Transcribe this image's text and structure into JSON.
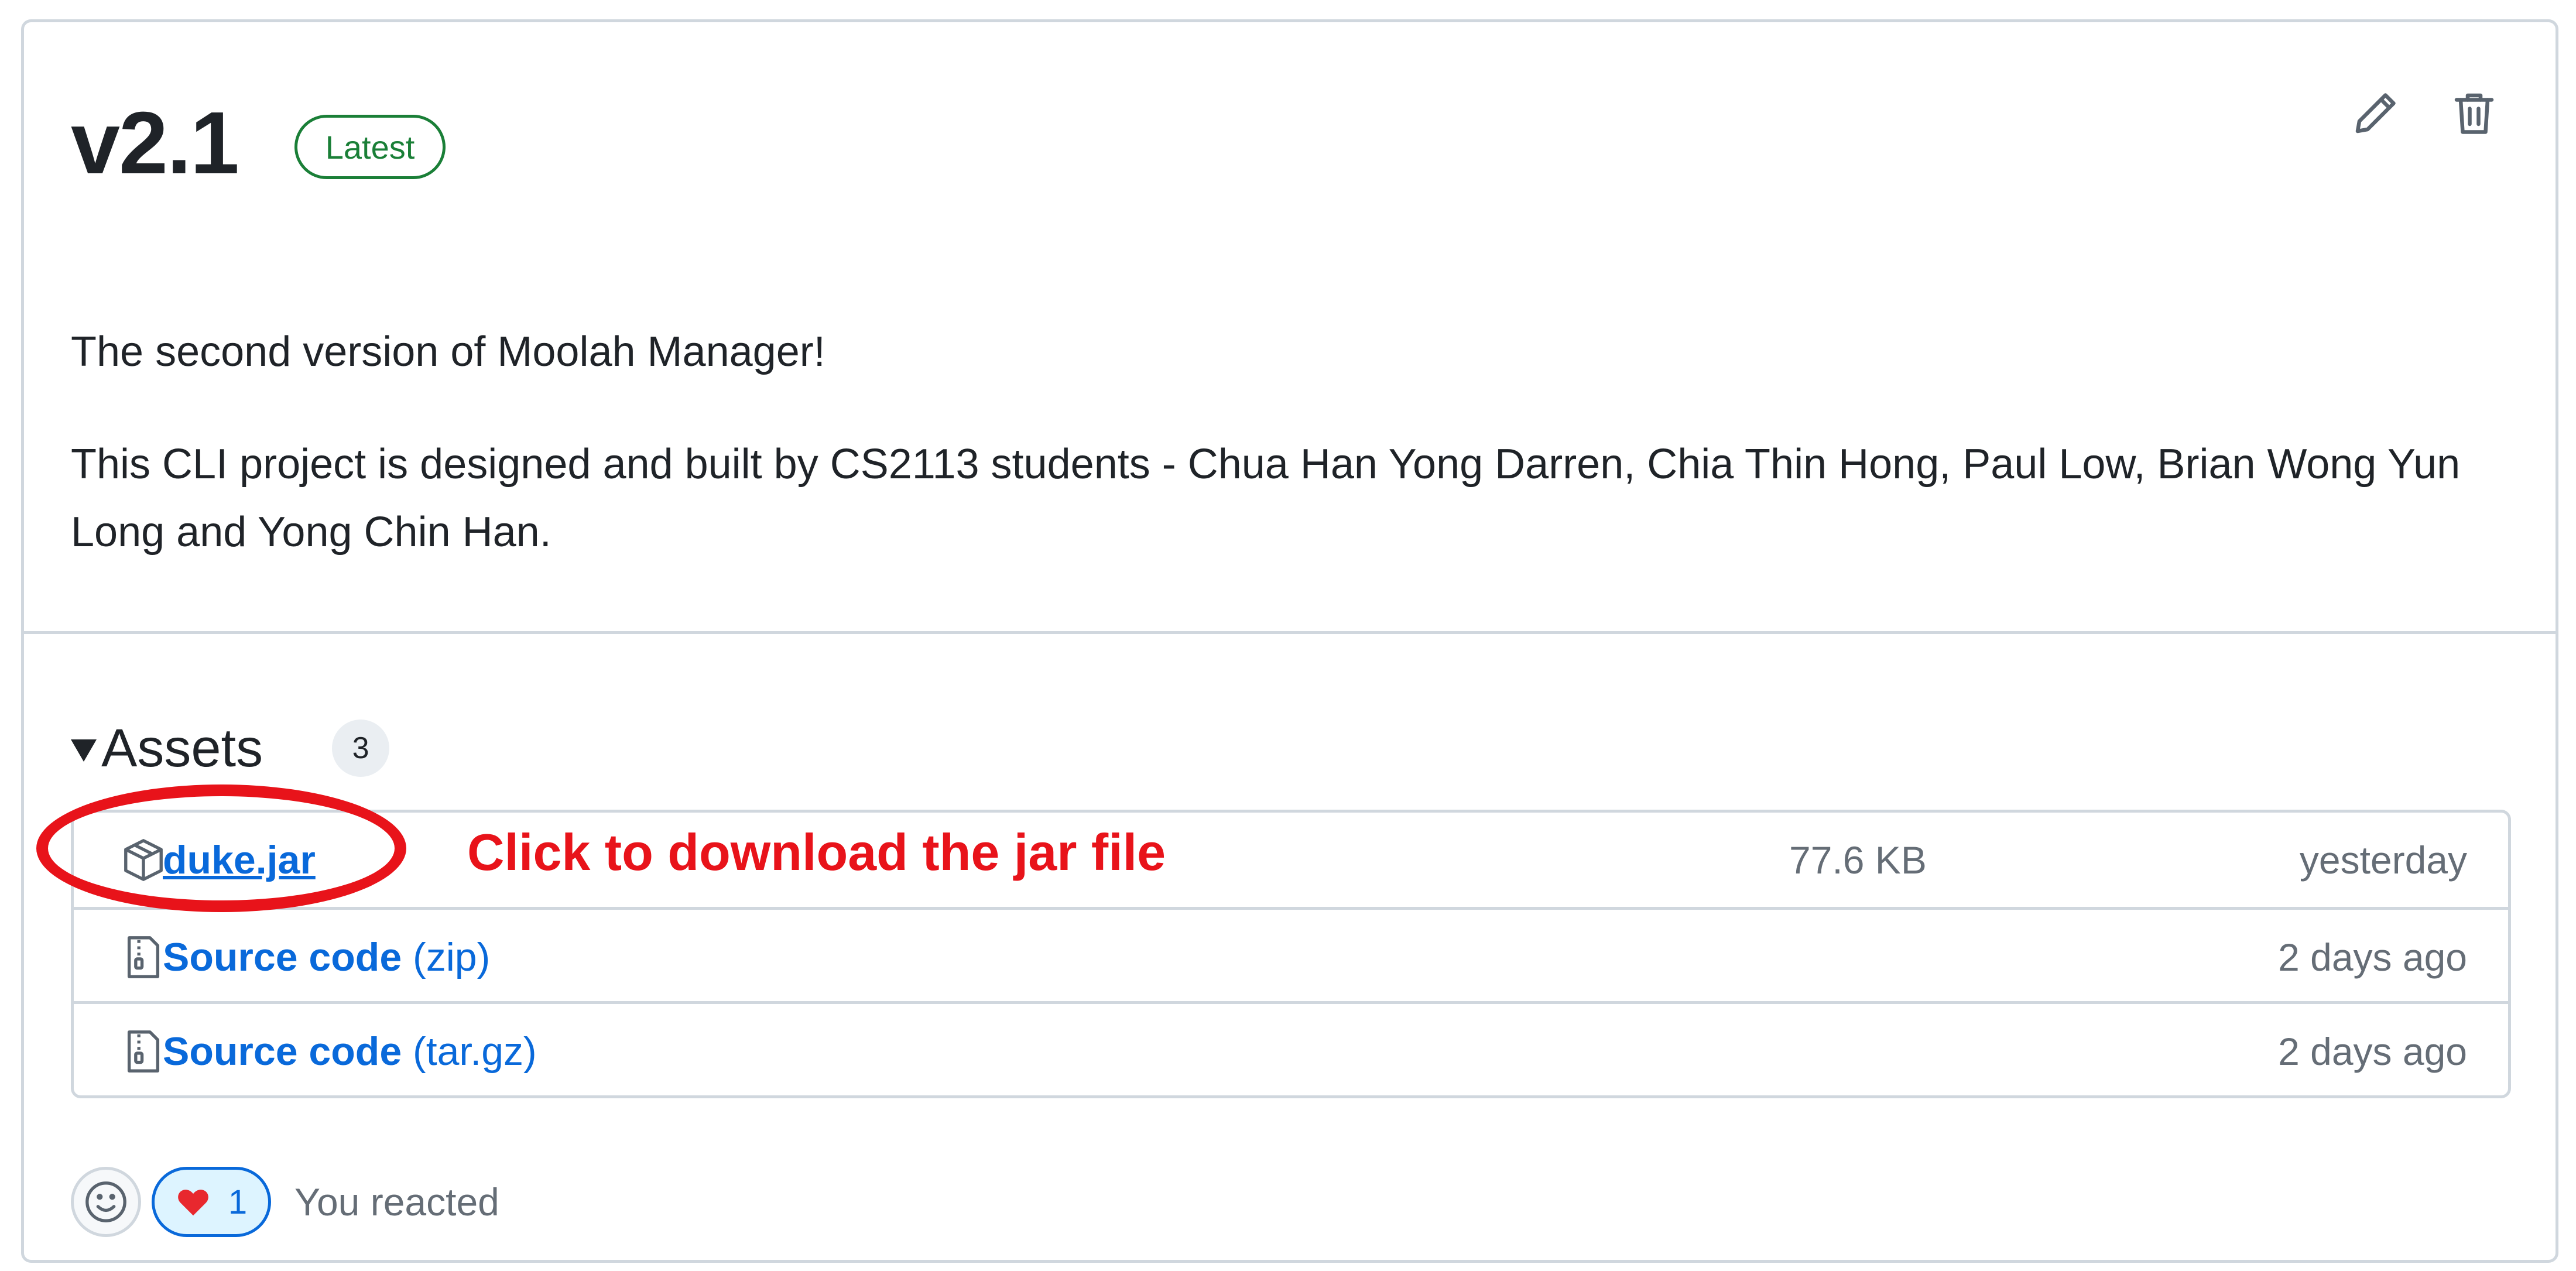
{
  "release": {
    "title": "v2.1",
    "badge": "Latest",
    "body": {
      "line1": "The second version of Moolah Manager!",
      "line2": "This CLI project is designed and built by CS2113 students - Chua Han Yong Darren, Chia Thin Hong, Paul Low, Brian Wong Yun Long and Yong Chin Han."
    },
    "icons": {
      "edit": "pencil-icon",
      "delete": "trash-icon"
    }
  },
  "assets": {
    "title": "Assets",
    "count": "3",
    "items": [
      {
        "name": "duke.jar",
        "ext": "",
        "size": "77.6 KB",
        "date": "yesterday",
        "icon": "package-icon"
      },
      {
        "name": "Source code",
        "ext": "(zip)",
        "size": "",
        "date": "2 days ago",
        "icon": "file-zip-icon"
      },
      {
        "name": "Source code",
        "ext": "(tar.gz)",
        "size": "",
        "date": "2 days ago",
        "icon": "file-zip-icon"
      }
    ]
  },
  "annotation": {
    "text": "Click to download the jar file",
    "color": "#e8131a"
  },
  "reactions": {
    "heart_count": "1",
    "status": "You reacted"
  },
  "colors": {
    "link": "#0969da",
    "latest_green": "#1a7f37",
    "border": "#d0d7de",
    "muted": "#656d76"
  }
}
